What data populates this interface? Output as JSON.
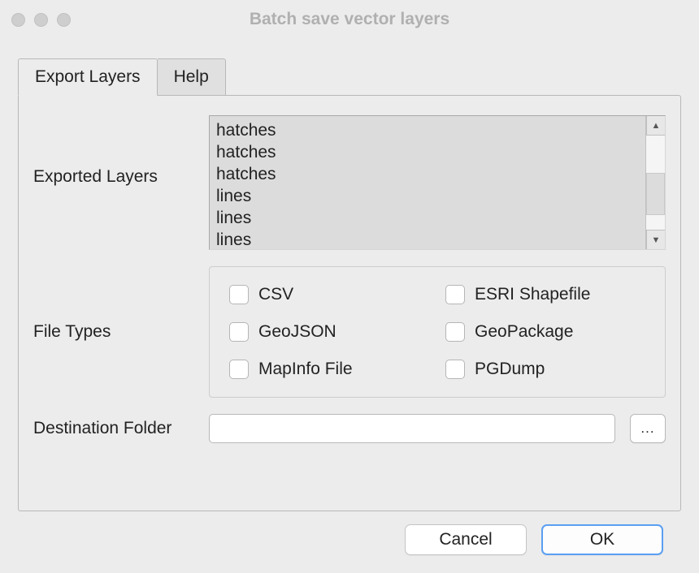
{
  "window": {
    "title": "Batch save vector layers"
  },
  "tabs": {
    "export": "Export Layers",
    "help": "Help"
  },
  "labels": {
    "exported_layers": "Exported Layers",
    "file_types": "File Types",
    "destination_folder": "Destination Folder"
  },
  "exported_layers_list": [
    "hatches",
    "hatches",
    "hatches",
    "lines",
    "lines",
    "lines"
  ],
  "file_types": {
    "csv": "CSV",
    "esri": "ESRI Shapefile",
    "geojson": "GeoJSON",
    "geopackage": "GeoPackage",
    "mapinfo": "MapInfo File",
    "pgdump": "PGDump"
  },
  "destination": {
    "value": "",
    "browse_label": "..."
  },
  "buttons": {
    "cancel": "Cancel",
    "ok": "OK"
  },
  "scroll": {
    "up": "▲",
    "down": "▼"
  }
}
